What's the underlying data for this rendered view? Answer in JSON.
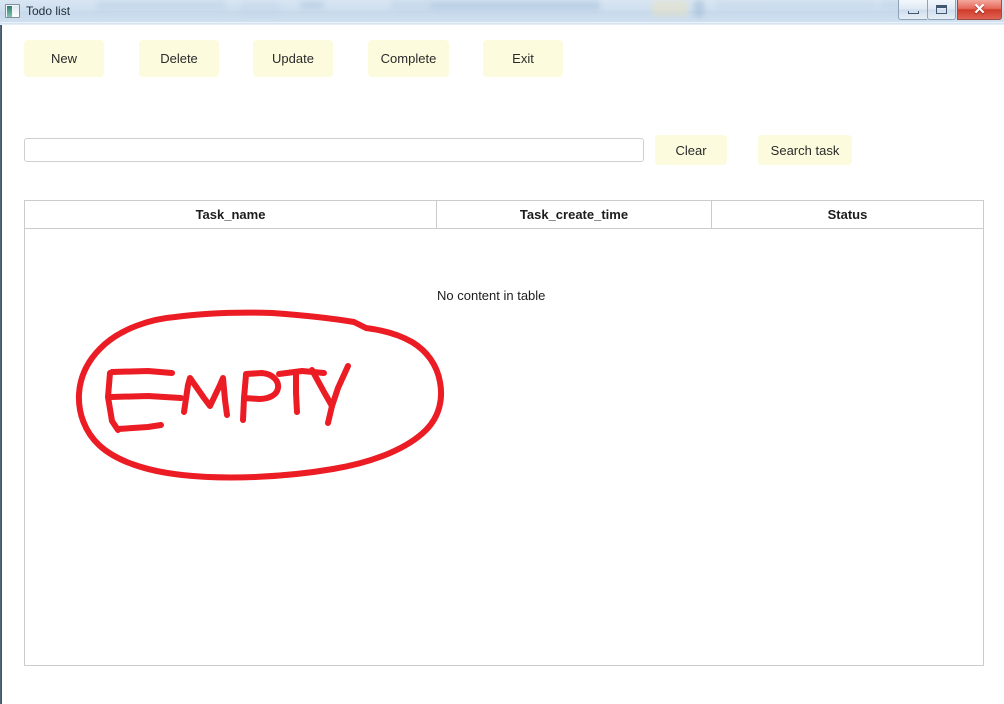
{
  "window": {
    "title": "Todo list",
    "icon": "app-window-icon",
    "controls": {
      "minimize_label": "–",
      "maximize_label": "□",
      "close_label": "✕"
    }
  },
  "toolbar": {
    "buttons": [
      {
        "label": "New",
        "name": "new-button"
      },
      {
        "label": "Delete",
        "name": "delete-button"
      },
      {
        "label": "Update",
        "name": "update-button"
      },
      {
        "label": "Complete",
        "name": "complete-button"
      },
      {
        "label": "Exit",
        "name": "exit-button"
      }
    ]
  },
  "search": {
    "input_value": "",
    "input_placeholder": "",
    "clear_label": "Clear",
    "search_label": "Search task"
  },
  "table": {
    "columns": [
      {
        "label": "Task_name"
      },
      {
        "label": "Task_create_time"
      },
      {
        "label": "Status"
      }
    ],
    "rows": [],
    "empty_message": "No content in table"
  },
  "annotation": {
    "text": "EMPTY",
    "color": "#ec1c24",
    "shape": "hand-drawn-ellipse",
    "stroke_width": 6
  },
  "colors": {
    "button_fill": "#fdfbdd",
    "window_titlebar": "#cbdcee",
    "close_button": "#cf3b2b",
    "table_border": "#cccccc",
    "annotation_red": "#ec1c24"
  }
}
